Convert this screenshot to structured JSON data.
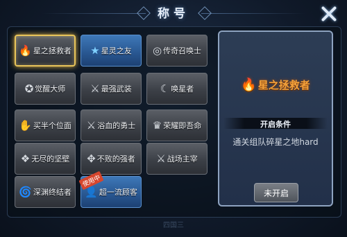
{
  "header": {
    "title": "称号",
    "close_icon": "close-icon"
  },
  "titles": [
    {
      "id": "star-savior",
      "label": "星之拯救者",
      "icon": "flame-icon",
      "glyph": "🔥",
      "selected": true,
      "style": "normal"
    },
    {
      "id": "star-spirit-friend",
      "label": "星灵之友",
      "icon": "star-icon",
      "glyph": "★",
      "selected": false,
      "style": "blue"
    },
    {
      "id": "legend-summoner",
      "label": "传奇召唤士",
      "icon": "swirl-icon",
      "glyph": "◎",
      "selected": false,
      "style": "normal"
    },
    {
      "id": "awakened-master",
      "label": "觉醒大师",
      "icon": "emblem-icon",
      "glyph": "✪",
      "selected": false,
      "style": "normal"
    },
    {
      "id": "strongest-armed",
      "label": "最强武装",
      "icon": "armor-icon",
      "glyph": "⚔",
      "selected": false,
      "style": "normal"
    },
    {
      "id": "star-caller",
      "label": "唤星者",
      "icon": "moon-star-icon",
      "glyph": "☾",
      "selected": false,
      "style": "normal"
    },
    {
      "id": "half-position",
      "label": "买半个位面",
      "icon": "hand-coin-icon",
      "glyph": "✋",
      "selected": false,
      "style": "normal"
    },
    {
      "id": "bloodbathed-warrior",
      "label": "浴血的勇士",
      "icon": "blade-icon",
      "glyph": "⚔",
      "selected": false,
      "style": "normal"
    },
    {
      "id": "glory-is-life",
      "label": "荣耀即吾命",
      "icon": "lion-icon",
      "glyph": "♛",
      "selected": false,
      "style": "normal"
    },
    {
      "id": "endless-fortress",
      "label": "无尽的坚壁",
      "icon": "wings-icon",
      "glyph": "❖",
      "selected": false,
      "style": "normal"
    },
    {
      "id": "undefeated-strong",
      "label": "不败的强者",
      "icon": "winged-icon",
      "glyph": "✥",
      "selected": false,
      "style": "normal"
    },
    {
      "id": "battlefield-lord",
      "label": "战场主宰",
      "icon": "sword-icon",
      "glyph": "⚔",
      "selected": false,
      "style": "normal"
    },
    {
      "id": "abyss-ender",
      "label": "深渊终结者",
      "icon": "vortex-icon",
      "glyph": "🌀",
      "selected": false,
      "style": "normal"
    },
    {
      "id": "top-customer",
      "label": "超一流顾客",
      "icon": "person-icon",
      "glyph": "👤",
      "selected": false,
      "style": "blue",
      "badge": "使用中"
    }
  ],
  "detail": {
    "title": "星之拯救者",
    "icon": "flame-icon",
    "glyph": "🔥",
    "condition_label": "开启条件",
    "condition_text": "通关组队碎星之地hard",
    "button_label": "未开启"
  },
  "footer_text": "四国三"
}
